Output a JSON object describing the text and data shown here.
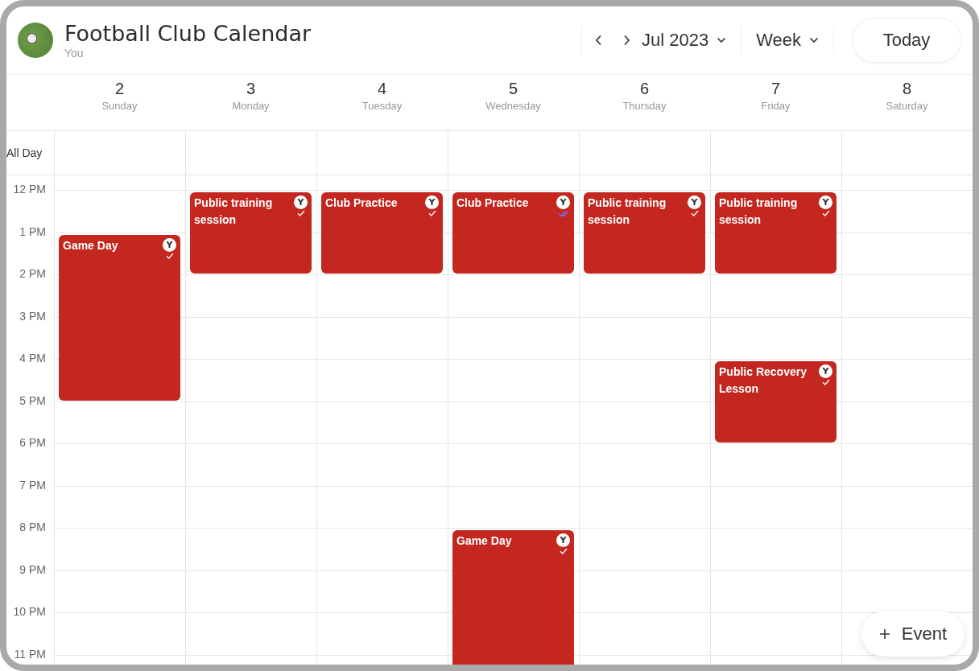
{
  "header": {
    "title": "Football Club Calendar",
    "subtitle": "You",
    "month": "Jul 2023",
    "view": "Week",
    "today_button": "Today"
  },
  "all_day_label": "All Day",
  "hours": [
    "12 PM",
    "1 PM",
    "2 PM",
    "3 PM",
    "4 PM",
    "5 PM",
    "6 PM",
    "7 PM",
    "8 PM",
    "9 PM",
    "10 PM",
    "11 PM"
  ],
  "days": [
    {
      "date": "2",
      "weekday": "Sunday",
      "slots": [
        {
          "kind": "free"
        },
        {
          "kind": "event",
          "title": "Game Day",
          "badge": "Y",
          "double_tick": false
        },
        {
          "kind": "continued"
        },
        {
          "kind": "continued"
        },
        {
          "kind": "continued"
        }
      ]
    },
    {
      "date": "3",
      "weekday": "Monday",
      "slots": [
        {
          "kind": "event",
          "title": "Public training session",
          "badge": "Y",
          "double_tick": false
        },
        {
          "kind": "continued"
        }
      ]
    },
    {
      "date": "4",
      "weekday": "Tuesday",
      "slots": [
        {
          "kind": "event",
          "title": "Club Practice",
          "badge": "Y",
          "double_tick": false
        },
        {
          "kind": "continued"
        }
      ]
    },
    {
      "date": "5",
      "weekday": "Wednesday",
      "slots": [
        {
          "kind": "event",
          "title": "Club Practice",
          "badge": "Y",
          "double_tick": true
        },
        {
          "kind": "continued"
        },
        {
          "kind": "free"
        },
        {
          "kind": "free"
        },
        {
          "kind": "free"
        },
        {
          "kind": "free"
        },
        {
          "kind": "free"
        },
        {
          "kind": "free"
        },
        {
          "kind": "event",
          "title": "Game Day",
          "badge": "Y",
          "double_tick": false
        },
        {
          "kind": "continued"
        },
        {
          "kind": "continued"
        },
        {
          "kind": "continued"
        }
      ]
    },
    {
      "date": "6",
      "weekday": "Thursday",
      "slots": [
        {
          "kind": "event",
          "title": "Public training session",
          "badge": "Y",
          "double_tick": false
        },
        {
          "kind": "continued"
        }
      ]
    },
    {
      "date": "7",
      "weekday": "Friday",
      "slots": [
        {
          "kind": "event",
          "title": "Public training session",
          "badge": "Y",
          "double_tick": false
        },
        {
          "kind": "continued"
        },
        {
          "kind": "free"
        },
        {
          "kind": "free"
        },
        {
          "kind": "event",
          "title": "Public Recovery Lesson",
          "badge": "Y",
          "double_tick": false
        },
        {
          "kind": "continued"
        }
      ]
    },
    {
      "date": "8",
      "weekday": "Saturday"
    }
  ],
  "add_event_button": {
    "label": "Event"
  }
}
